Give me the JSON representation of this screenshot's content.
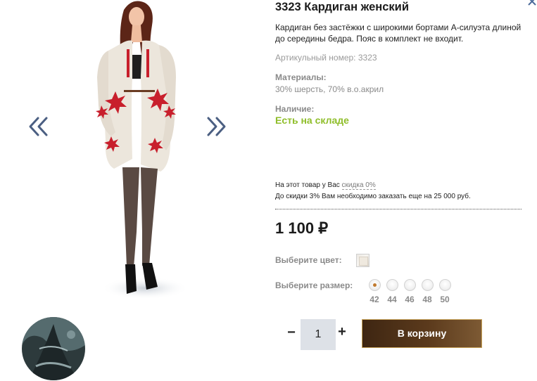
{
  "product": {
    "title": "3323 Кардиган женский",
    "description": "Кардиган без застёжки с широкими бортами А-силуэта длиной до середины бедра. Пояс в комплект не входит.",
    "article": "Артикульный номер: 3323",
    "materials_label": "Материалы:",
    "materials_value": "30% шерсть, 70% в.о.акрил",
    "availability_label": "Наличие:",
    "availability_value": "Есть на складе",
    "availability_color": "#8fbe2a"
  },
  "discount": {
    "line1_prefix": "На этот товар у Вас",
    "line1_link": "скидка 0%",
    "line2": "До скидки 3% Вам необходимо заказать еще на 25 000 руб."
  },
  "price": "1 100 ₽",
  "options": {
    "color_label": "Выберите цвет:",
    "size_label": "Выберите размер:",
    "sizes": [
      "42",
      "44",
      "46",
      "48",
      "50"
    ],
    "selected_size": "42"
  },
  "cart": {
    "quantity": "1",
    "minus": "−",
    "plus": "+",
    "button_label": "В корзину",
    "button_color": "#4a2f17"
  },
  "gallery": {
    "prev_icon": "double-chevron-left-icon",
    "next_icon": "double-chevron-right-icon",
    "arrow_color": "#4b5f82"
  }
}
